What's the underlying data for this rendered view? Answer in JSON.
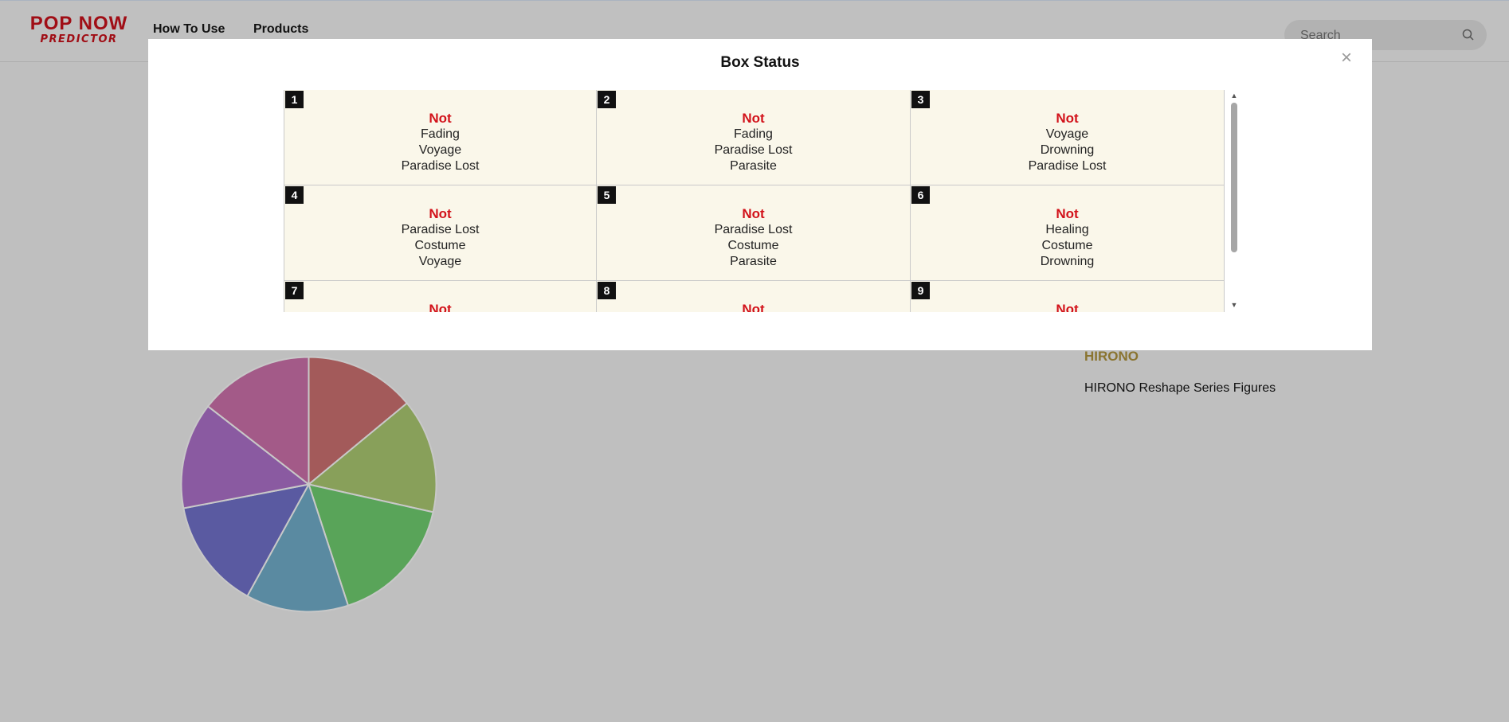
{
  "header": {
    "logo_main": "POP NOW",
    "logo_sub": "PREDICTOR",
    "nav": [
      "How To Use",
      "Products"
    ],
    "search_placeholder": "Search"
  },
  "modal": {
    "title": "Box Status",
    "close_label": "×",
    "boxes": [
      {
        "num": "1",
        "status": "Not",
        "items": [
          "Fading",
          "Voyage",
          "Paradise Lost"
        ]
      },
      {
        "num": "2",
        "status": "Not",
        "items": [
          "Fading",
          "Paradise Lost",
          "Parasite"
        ]
      },
      {
        "num": "3",
        "status": "Not",
        "items": [
          "Voyage",
          "Drowning",
          "Paradise Lost"
        ]
      },
      {
        "num": "4",
        "status": "Not",
        "items": [
          "Paradise Lost",
          "Costume",
          "Voyage"
        ]
      },
      {
        "num": "5",
        "status": "Not",
        "items": [
          "Paradise Lost",
          "Costume",
          "Parasite"
        ]
      },
      {
        "num": "6",
        "status": "Not",
        "items": [
          "Healing",
          "Costume",
          "Drowning"
        ]
      },
      {
        "num": "7",
        "status": "Not",
        "items": []
      },
      {
        "num": "8",
        "status": "Not",
        "items": []
      },
      {
        "num": "9",
        "status": "Not",
        "items": []
      }
    ]
  },
  "product": {
    "brand": "HIRONO",
    "description": "HIRONO Reshape Series Figures"
  },
  "chart_data": {
    "type": "pie",
    "values": [
      14,
      14.5,
      16.5,
      13,
      14,
      13.5,
      14.5
    ],
    "colors": [
      "#a35a5a",
      "#88a05a",
      "#59a459",
      "#5a8aa1",
      "#5a5aa1",
      "#8a5aa1",
      "#a35a88"
    ]
  },
  "colors": {
    "brand_red": "#a00d15",
    "status_red": "#d2121a",
    "brand_gold": "#8a7430",
    "cell_bg": "#faf7ea"
  }
}
